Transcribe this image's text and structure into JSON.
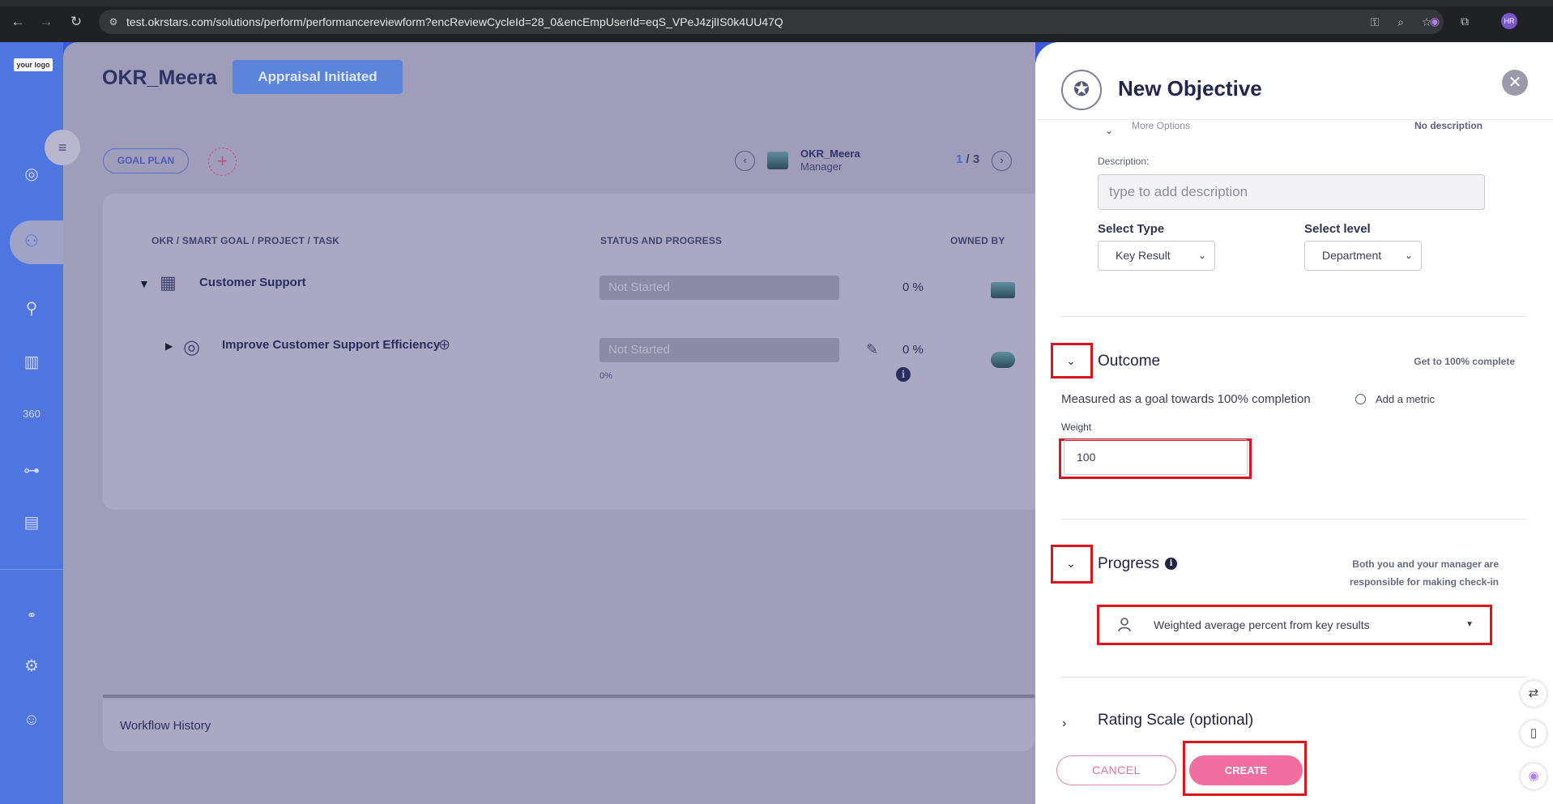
{
  "browser": {
    "url": "test.okrstars.com/solutions/perform/performancereviewform?encReviewCycleId=28_0&encEmpUserId=eqS_VPeJ4zjlIS0k4UU47Q",
    "profile_initials": "HR"
  },
  "sidebar": {
    "logo_text": "your logo",
    "items": [
      "target-icon",
      "team-icon",
      "person-icon",
      "book-icon",
      "review-360-icon",
      "hierarchy-icon",
      "report-icon",
      "integration-icon",
      "settings-icon",
      "support-icon"
    ]
  },
  "page": {
    "title": "OKR_Meera",
    "status_button": "Appraisal Initiated",
    "goal_plan": "GOAL PLAN",
    "manager_name": "OKR_Meera",
    "manager_role": "Manager",
    "page_current": "1",
    "page_total": "/ 3",
    "columns": {
      "task": "OKR / SMART GOAL / PROJECT / TASK",
      "status": "STATUS AND PROGRESS",
      "owner": "OWNED BY"
    },
    "rows": [
      {
        "name": "Customer Support",
        "status": "Not Started",
        "pct": "0",
        "pct_unit": "%"
      },
      {
        "name": "Improve Customer Support Efficiency",
        "status": "Not Started",
        "pct": "0",
        "pct_unit": "%",
        "progress_text": "0%"
      }
    ],
    "workflow_history": "Workflow History"
  },
  "panel": {
    "title": "New Objective",
    "more_options": "More Options",
    "no_description": "No description",
    "description_label": "Description:",
    "description_placeholder": "type to add description",
    "select_type_label": "Select Type",
    "select_type_value": "Key Result",
    "select_level_label": "Select level",
    "select_level_value": "Department",
    "outcome": {
      "title": "Outcome",
      "note": "Get to 100% complete",
      "measured": "Measured as a goal towards 100% completion",
      "add_metric": "Add a metric",
      "weight_label": "Weight",
      "weight_value": "100"
    },
    "progress": {
      "title": "Progress",
      "note_line1": "Both you and your manager are",
      "note_line2": "responsible for making check-in",
      "method": "Weighted average percent from key results"
    },
    "rating": {
      "title": "Rating Scale (optional)"
    },
    "cancel_label": "CANCEL",
    "create_label": "CREATE"
  },
  "colors": {
    "accent": "#f16ea1",
    "brand_blue": "#4f76e0",
    "highlight": "#d9151f"
  }
}
